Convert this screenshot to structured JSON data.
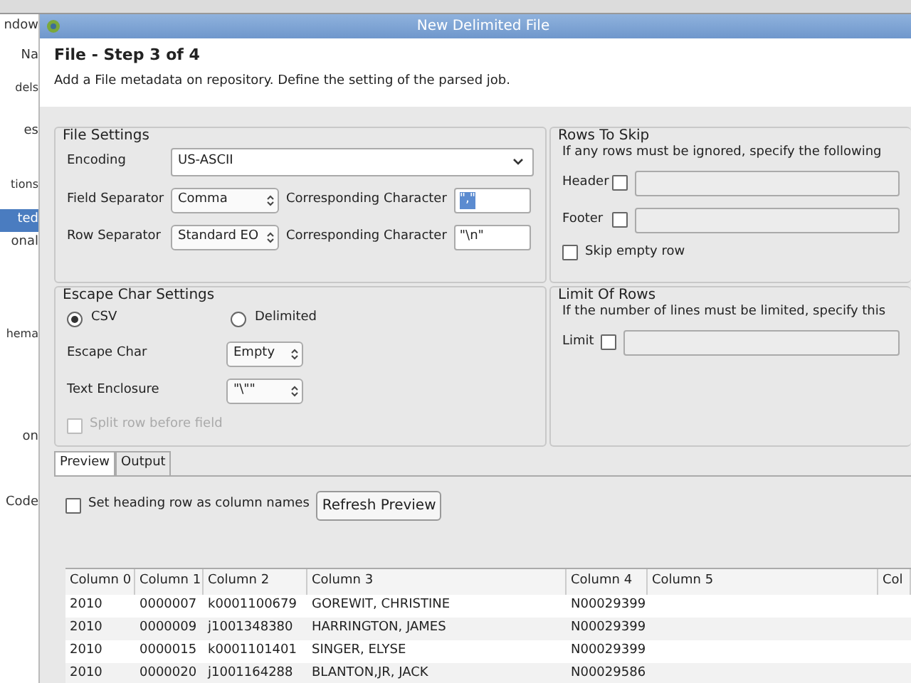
{
  "ide_sidebar": {
    "items": [
      {
        "label": "ndow",
        "selected": false,
        "kind": "menu"
      },
      {
        "label": "Na",
        "selected": false,
        "kind": "view"
      },
      {
        "label": "dels",
        "selected": false,
        "kind": "heading"
      },
      {
        "label": "es",
        "selected": false,
        "kind": "item"
      },
      {
        "label": "tions",
        "selected": false,
        "kind": "heading"
      },
      {
        "label": "ted",
        "selected": true,
        "kind": "item"
      },
      {
        "label": "onal",
        "selected": false,
        "kind": "item"
      },
      {
        "label": "hema",
        "selected": false,
        "kind": "heading"
      },
      {
        "label": "on",
        "selected": false,
        "kind": "item"
      },
      {
        "label": "Code",
        "selected": false,
        "kind": "view"
      }
    ]
  },
  "window": {
    "title": "New Delimited File"
  },
  "header": {
    "step": "File - Step 3 of 4",
    "description": "Add a File metadata on repository. Define the setting of the parsed job."
  },
  "file_settings": {
    "title": "File Settings",
    "encoding": {
      "label": "Encoding",
      "value": "US-ASCII"
    },
    "separators": [
      {
        "label": "Field Separator",
        "value": "Comma",
        "char_label": "Corresponding Character",
        "char_value": "\",\"",
        "char_selected": true
      },
      {
        "label": "Row Separator",
        "value": "Standard EO",
        "char_label": "Corresponding Character",
        "char_value": "\"\\n\"",
        "char_selected": false
      }
    ]
  },
  "rows_to_skip": {
    "title": "Rows To Skip",
    "description": "If any rows must be ignored, specify the following",
    "options": [
      {
        "label": "Header",
        "checked": false,
        "kind": "field"
      },
      {
        "label": "Footer",
        "checked": false,
        "kind": "field"
      },
      {
        "label": "Skip empty row",
        "checked": false,
        "kind": "plain"
      }
    ]
  },
  "escape_settings": {
    "title": "Escape Char Settings",
    "modes": [
      {
        "label": "CSV",
        "selected": true
      },
      {
        "label": "Delimited",
        "selected": false
      }
    ],
    "spinners": [
      {
        "label": "Escape Char",
        "value": "Empty"
      },
      {
        "label": "Text Enclosure",
        "value": "\"\\\"\""
      }
    ],
    "split_row": {
      "label": "Split row before field",
      "checked": false,
      "disabled": true
    }
  },
  "limit_of_rows": {
    "title": "Limit Of Rows",
    "description": "If the number of lines must be limited, specify this",
    "limit": {
      "label": "Limit",
      "checked": false
    }
  },
  "tabs": [
    {
      "label": "Preview",
      "selected": true
    },
    {
      "label": "Output",
      "selected": false
    }
  ],
  "preview": {
    "heading_row": {
      "label": "Set heading row as column names",
      "checked": false
    },
    "refresh_button": "Refresh Preview",
    "table": {
      "columns": [
        "Column 0",
        "Column 1",
        "Column 2",
        "Column 3",
        "Column 4",
        "Column 5",
        "Col"
      ],
      "rows": [
        [
          "2010",
          "0000007",
          "k0001100679",
          "GOREWIT, CHRISTINE",
          "N00029399"
        ],
        [
          "2010",
          "0000009",
          "j1001348380",
          "HARRINGTON, JAMES",
          "N00029399"
        ],
        [
          "2010",
          "0000015",
          "k0001101401",
          "SINGER, ELYSE",
          "N00029399"
        ],
        [
          "2010",
          "0000020",
          "j1001164288",
          "BLANTON,JR, JACK",
          "N00029586"
        ]
      ]
    }
  }
}
